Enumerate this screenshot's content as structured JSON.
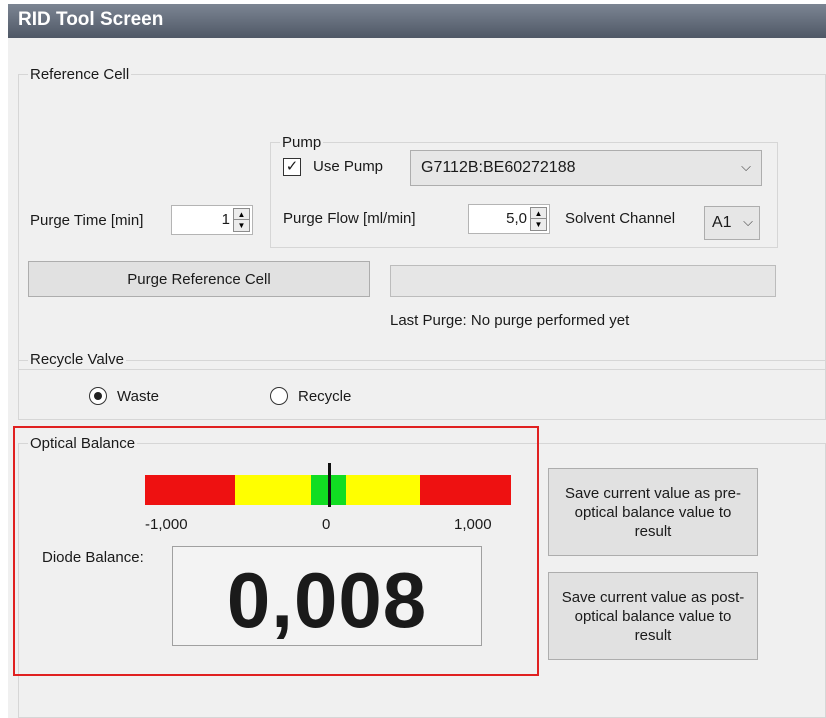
{
  "window": {
    "title": "RID Tool Screen"
  },
  "reference_cell": {
    "legend": "Reference Cell",
    "purge_time_label": "Purge Time [min]",
    "purge_time_value": "1",
    "pump": {
      "legend": "Pump",
      "use_pump_label": "Use Pump",
      "use_pump_checked": true,
      "pump_select_value": "G7112B:BE60272188",
      "purge_flow_label": "Purge Flow [ml/min]",
      "purge_flow_value": "5,0",
      "solvent_channel_label": "Solvent Channel",
      "solvent_channel_value": "A1"
    },
    "purge_button_label": "Purge Reference Cell",
    "progress": 0,
    "last_purge_text": "Last Purge: No purge performed yet"
  },
  "recycle_valve": {
    "legend": "Recycle Valve",
    "options": [
      "Waste",
      "Recycle"
    ],
    "selected": "Waste"
  },
  "optical_balance": {
    "legend": "Optical Balance",
    "scale_min": "-1,000",
    "scale_mid": "0",
    "scale_max": "1,000",
    "gauge_value": 0.008,
    "gauge_colors": {
      "red": "#ee1111",
      "yellow": "#ffff00",
      "green": "#11dd22"
    },
    "diode_label": "Diode Balance:",
    "diode_value": "0,008",
    "save_pre_label": "Save current value as pre-optical balance value to result",
    "save_post_label": "Save current value as post-optical balance value to result"
  },
  "highlight_color": "#e02020"
}
